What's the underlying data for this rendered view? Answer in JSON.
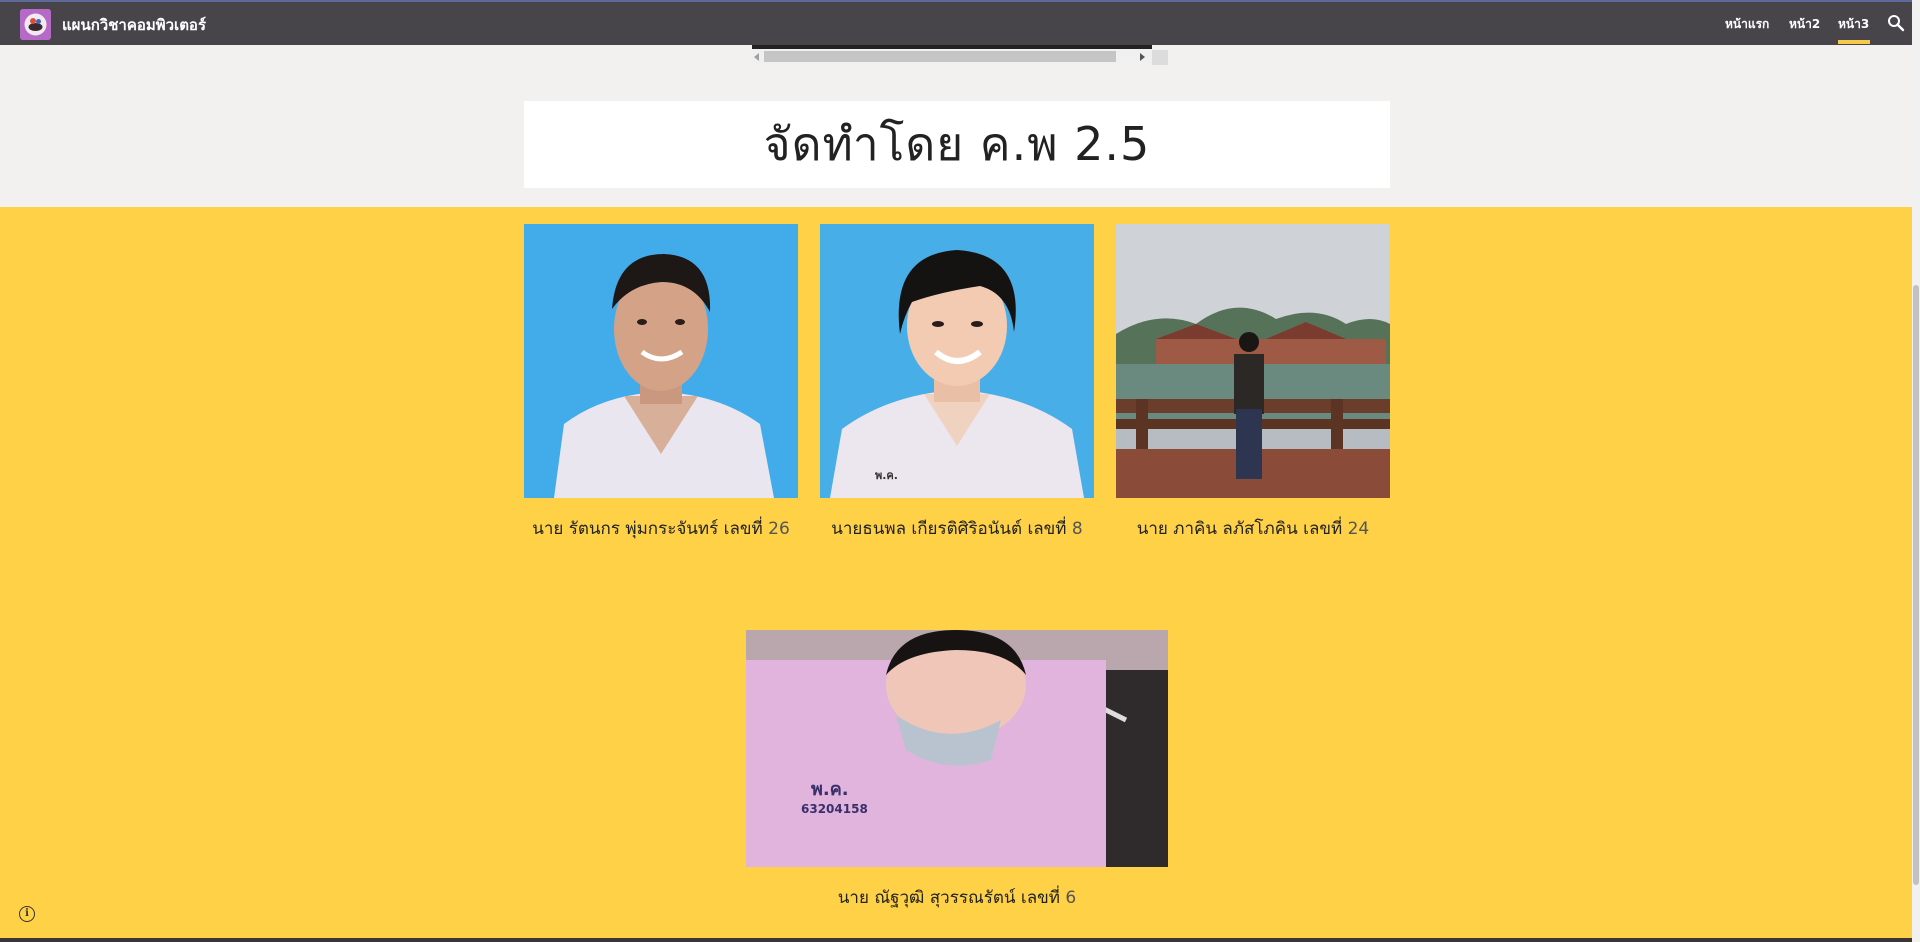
{
  "site": {
    "title": "แผนกวิชาคอมพิวเตอร์"
  },
  "nav": {
    "items": [
      {
        "label": "หน้าแรก",
        "active": false
      },
      {
        "label": "หน้า2",
        "active": false
      },
      {
        "label": "หน้า3",
        "active": true
      }
    ],
    "search_icon": "search-icon"
  },
  "heading": "จัดทำโดย ค.พ 2.5",
  "members": [
    {
      "caption_name": "นาย รัตนกร พุ่มกระจันทร์ เลขที่ ",
      "caption_num": "26"
    },
    {
      "caption_name": "นายธนพล เกียรติศิริอนันต์ เลขที่ ",
      "caption_num": "8"
    },
    {
      "caption_name": "นาย ภาคิน ลภัสโภคิน เลขที่ ",
      "caption_num": "24"
    },
    {
      "caption_name": "นาย ณัฐวุฒิ สุวรรณรัตน์ เลขที่ ",
      "caption_num": "6"
    }
  ],
  "colors": {
    "nav_bg": "#48454a",
    "accent": "#fed147",
    "page_bg": "#f3f1ef"
  }
}
